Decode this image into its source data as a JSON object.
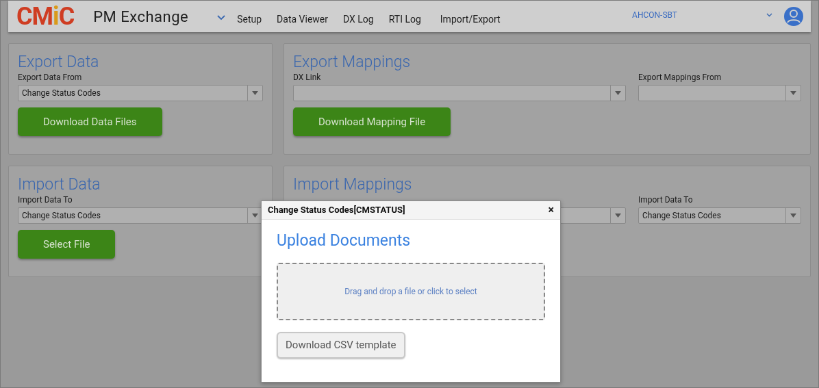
{
  "header": {
    "logo": "CMiC",
    "app_title": "PM Exchange",
    "nav": [
      "Setup",
      "Data Viewer",
      "DX Log",
      "RTI Log",
      "Import/Export"
    ],
    "company": "AHCON-SBT"
  },
  "cards": [
    {
      "title": "Export Data",
      "fields": [
        {
          "kind": "dropdown",
          "label": "Export Data From",
          "value": "Change Status Codes"
        }
      ],
      "button": "Download Data Files"
    },
    {
      "title": "Export Mappings",
      "fields": [
        {
          "kind": "dropdown",
          "label": "DX Link"
        },
        {
          "kind": "dropdown",
          "label": "Export Mappings From"
        }
      ],
      "button": "Download Mapping File"
    },
    {
      "title": "Import Data",
      "fields": [
        {
          "kind": "dropdown",
          "label": "Import Data To",
          "value": "Change Status Codes"
        }
      ],
      "button": "Select File"
    },
    {
      "title": "Import Mappings",
      "fields": [
        {
          "kind": "dropdown"
        },
        {
          "kind": "dropdown",
          "label": "Import Data To",
          "value": "Change Status Codes"
        }
      ]
    }
  ],
  "dialog": {
    "title": "Change Status Codes[CMSTATUS]",
    "close": "×",
    "heading": "Upload Documents",
    "dropzone": "Drag and drop a file or click to select",
    "button": "Download CSV template"
  }
}
